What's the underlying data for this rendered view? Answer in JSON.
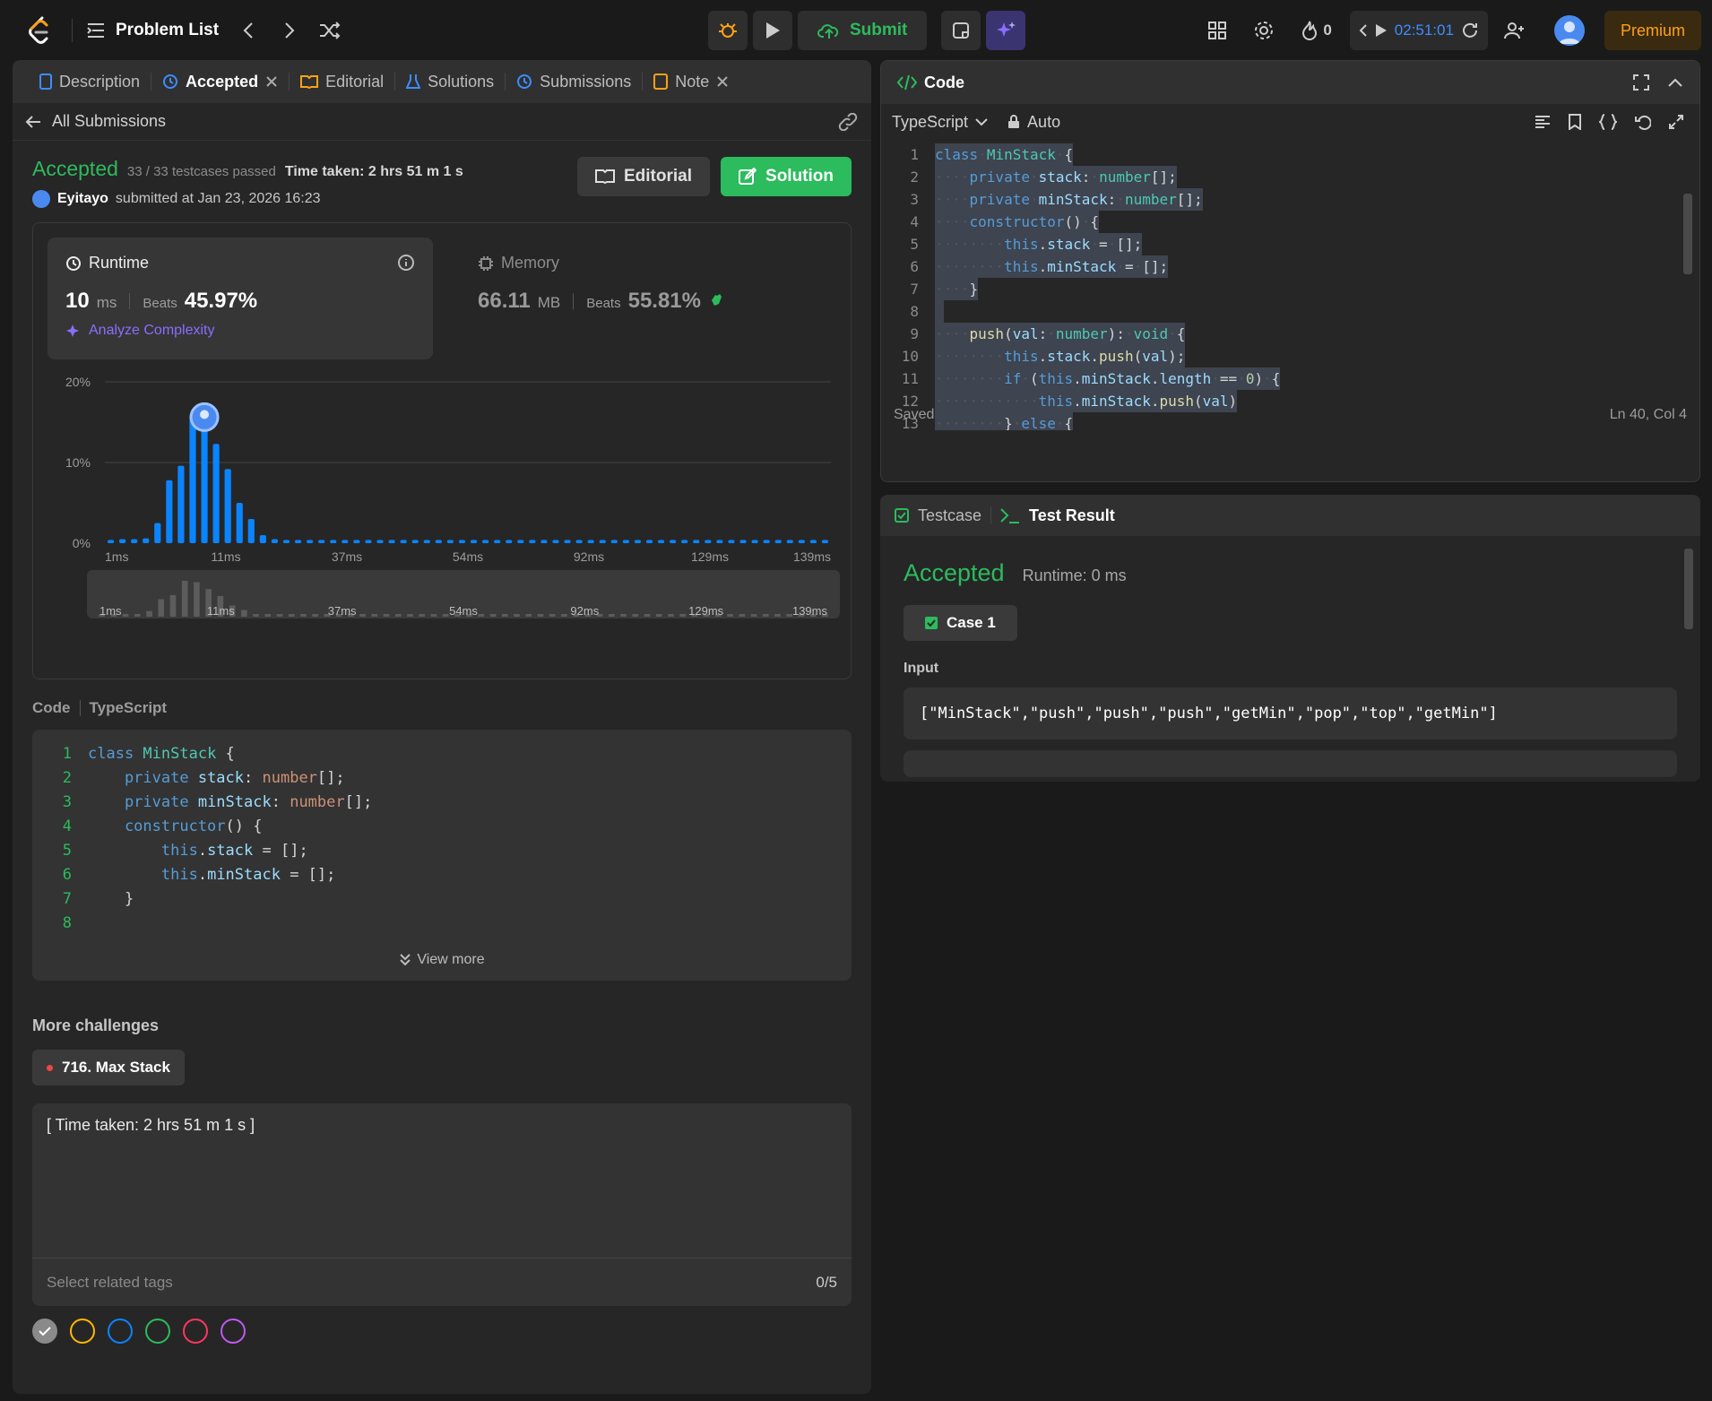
{
  "topbar": {
    "problem_list": "Problem List",
    "submit": "Submit",
    "streak": "0",
    "timer": "02:51:01",
    "premium": "Premium"
  },
  "tabs": [
    {
      "label": "Description"
    },
    {
      "label": "Accepted"
    },
    {
      "label": "Editorial"
    },
    {
      "label": "Solutions"
    },
    {
      "label": "Submissions"
    },
    {
      "label": "Note"
    }
  ],
  "submission": {
    "back": "All Submissions",
    "status": "Accepted",
    "passed": "33 / 33 testcases passed",
    "time_taken": "Time taken: 2 hrs 51 m 1 s",
    "user": "Eyitayo",
    "submitted_at": "submitted at Jan 23, 2026 16:23",
    "editorial_btn": "Editorial",
    "solution_btn": "Solution"
  },
  "runtime": {
    "title": "Runtime",
    "value": "10",
    "unit": "ms",
    "beats_label": "Beats",
    "beats": "45.97%",
    "analyze": "Analyze Complexity"
  },
  "memory": {
    "title": "Memory",
    "value": "66.11",
    "unit": "MB",
    "beats_label": "Beats",
    "beats": "55.81%"
  },
  "chart_data": {
    "type": "bar",
    "y_ticks": [
      "20%",
      "10%",
      "0%"
    ],
    "x_ticks": [
      "1ms",
      "11ms",
      "37ms",
      "54ms",
      "92ms",
      "129ms",
      "139ms"
    ],
    "ylim": [
      0,
      20
    ],
    "values": [
      0.4,
      0.5,
      0.5,
      0.6,
      2.5,
      7.8,
      9.6,
      16,
      15.4,
      12.3,
      9.2,
      5,
      3,
      1,
      0.5,
      0.4,
      0.4,
      0.4,
      0.4,
      0.4,
      0.4,
      0.4,
      0.4,
      0.4,
      0.4,
      0.4,
      0.4,
      0.4,
      0.4,
      0.4,
      0.4,
      0.4,
      0.4,
      0.4,
      0.4,
      0.4,
      0.4,
      0.4,
      0.4,
      0.4,
      0.4,
      0.4,
      0.4,
      0.4,
      0.4,
      0.4,
      0.4,
      0.4,
      0.4,
      0.4,
      0.4,
      0.4,
      0.4,
      0.4,
      0.4,
      0.4,
      0.4,
      0.4,
      0.4,
      0.4,
      0.4,
      0.4
    ],
    "highlight_index": 8,
    "color": "#0a84ff"
  },
  "code_section": {
    "title": "Code",
    "language": "TypeScript",
    "view_more": "View more"
  },
  "code_lines": [
    "class MinStack {",
    "    private stack: number[];",
    "    private minStack: number[];",
    "    constructor() {",
    "        this.stack = [];",
    "        this.minStack = [];",
    "    }",
    ""
  ],
  "more": {
    "title": "More challenges",
    "chip": "716. Max Stack"
  },
  "note": {
    "text": "[ Time taken: 2 hrs 51 m 1 s ]",
    "tags_placeholder": "Select related tags",
    "tags_count": "0/5"
  },
  "editor": {
    "title": "Code",
    "language": "TypeScript",
    "mode": "Auto",
    "saved": "Saved",
    "cursor": "Ln 40, Col 4"
  },
  "testpanel": {
    "tab1": "Testcase",
    "tab2": "Test Result",
    "status": "Accepted",
    "runtime": "Runtime: 0 ms",
    "case": "Case 1",
    "input_label": "Input",
    "input_value": "[\"MinStack\",\"push\",\"push\",\"push\",\"getMin\",\"pop\",\"top\",\"getMin\"]"
  },
  "colors": {
    "accent_green": "#2cbb5d",
    "premium": "#ffa116",
    "ai_purple": "#8a6eff"
  }
}
